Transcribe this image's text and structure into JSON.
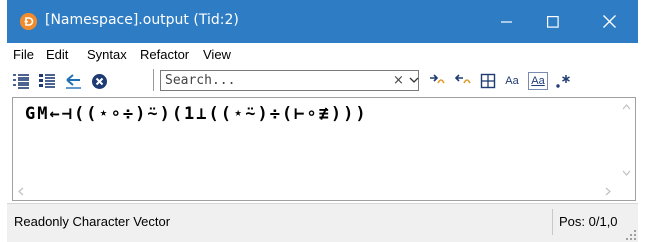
{
  "window": {
    "title": "[Namespace].output (Tid:2)",
    "title_bar_color": "#2d7cc4",
    "app_icon": "dyalog-apl-icon"
  },
  "menu": [
    "File",
    "Edit",
    "Syntax",
    "Refactor",
    "View"
  ],
  "toolbar": {
    "icons": [
      "list-icon",
      "indent-list-icon",
      "arrow-back-icon",
      "close-circle-icon",
      "next-match-icon",
      "previous-match-icon",
      "box-plus-icon",
      "match-case-icon",
      "match-whole-icon",
      "regex-icon"
    ],
    "match_case_label": "Aa",
    "match_whole_label": "Aa",
    "search_placeholder": "Search...",
    "clear_label": "×"
  },
  "editor": {
    "code": "GM←⊣((⋆∘÷)⍨)(1⊥((⋆⍨)÷(⊢∘≢)))"
  },
  "status": {
    "left": "Readonly Character Vector",
    "right": "Pos: 0/1,0"
  }
}
